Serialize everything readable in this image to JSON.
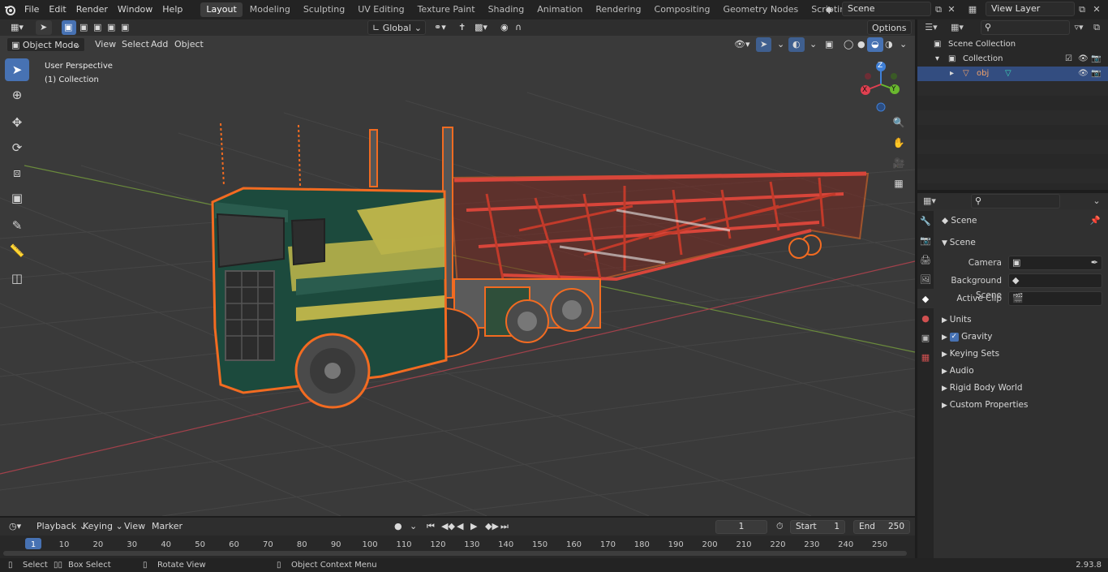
{
  "menu": [
    "File",
    "Edit",
    "Render",
    "Window",
    "Help"
  ],
  "workspaces": [
    "Layout",
    "Modeling",
    "Sculpting",
    "UV Editing",
    "Texture Paint",
    "Shading",
    "Animation",
    "Rendering",
    "Compositing",
    "Geometry Nodes",
    "Scripting"
  ],
  "active_workspace": "Layout",
  "scene_name": "Scene",
  "view_layer": "View Layer",
  "viewport": {
    "mode": "Object Mode",
    "menus": [
      "View",
      "Select",
      "Add",
      "Object"
    ],
    "transform_orientation": "Global",
    "options_label": "Options",
    "overlay_title": "User Perspective",
    "overlay_collection": "(1) Collection",
    "axes": {
      "x": "X",
      "y": "Y",
      "z": "Z"
    }
  },
  "outliner": {
    "search_placeholder": "",
    "rows": [
      "Scene Collection",
      "Collection",
      "obj"
    ]
  },
  "properties": {
    "context": "Scene",
    "panel": "Scene",
    "fields": [
      {
        "label": "Camera",
        "value": ""
      },
      {
        "label": "Background Scene",
        "value": ""
      },
      {
        "label": "Active Clip",
        "value": ""
      }
    ],
    "subpanels": [
      "Units",
      "Gravity",
      "Keying Sets",
      "Audio",
      "Rigid Body World",
      "Custom Properties"
    ],
    "gravity_enabled": true
  },
  "timeline": {
    "menus": [
      "Playback",
      "Keying",
      "View",
      "Marker"
    ],
    "current_frame": "1",
    "start_label": "Start",
    "start": "1",
    "end_label": "End",
    "end": "250",
    "ruler": [
      "1",
      "10",
      "20",
      "30",
      "40",
      "50",
      "60",
      "70",
      "80",
      "90",
      "100",
      "110",
      "120",
      "130",
      "140",
      "150",
      "160",
      "170",
      "180",
      "190",
      "200",
      "210",
      "220",
      "230",
      "240",
      "250"
    ]
  },
  "statusbar": {
    "items": [
      "Select",
      "Box Select",
      "Rotate View",
      "Object Context Menu"
    ],
    "version": "2.93.8"
  },
  "colors": {
    "accent": "#4772b3",
    "selection_orange": "#f26b21",
    "truck_green": "#1c4a3d",
    "truck_yellow": "#b9b24a",
    "trailer_red": "#c23a2a"
  }
}
